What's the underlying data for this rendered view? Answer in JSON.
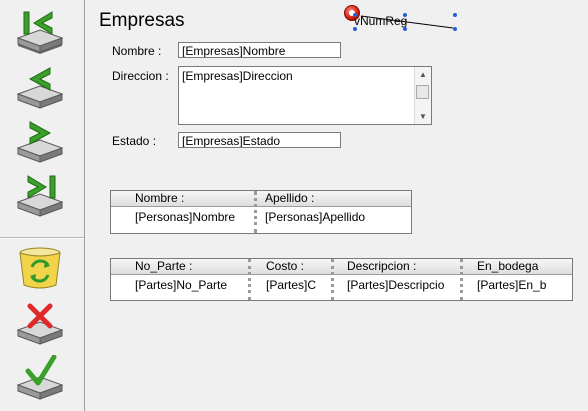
{
  "toolbar": {
    "buttons": [
      "first-record",
      "previous-record",
      "next-record",
      "last-record",
      "refresh",
      "cancel",
      "accept"
    ]
  },
  "form": {
    "title": "Empresas",
    "variable_label": "vNumReg",
    "labels": {
      "nombre": "Nombre :",
      "direccion": "Direccion :",
      "estado": "Estado :"
    },
    "fields": {
      "nombre": "[Empresas]Nombre",
      "direccion": "[Empresas]Direccion",
      "estado": "[Empresas]Estado"
    }
  },
  "personas_grid": {
    "headers": [
      "Nombre :",
      "Apellido :"
    ],
    "cells": [
      "[Personas]Nombre",
      "[Personas]Apellido"
    ]
  },
  "partes_grid": {
    "headers": [
      "No_Parte :",
      "Costo :",
      "Descripcion :",
      "En_bodega"
    ],
    "cells": [
      "[Partes]No_Parte",
      "[Partes]C",
      "[Partes]Descripcio",
      "[Partes]En_b"
    ]
  }
}
